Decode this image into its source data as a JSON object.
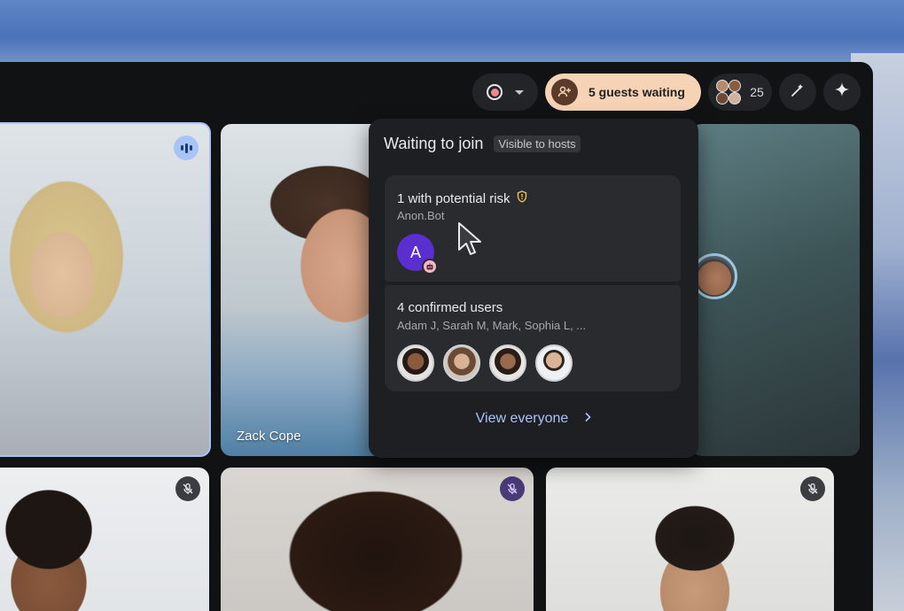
{
  "toolbar": {
    "record_icon": "record-icon",
    "guests_waiting_label": "5 guests waiting",
    "participant_count": "25",
    "colors": {
      "guests_pill_bg": "#f6d3b5",
      "accent": "#a8c4f7"
    }
  },
  "tiles": {
    "zack_name": "Zack Cope"
  },
  "popup": {
    "title": "Waiting to join",
    "visibility_chip": "Visible to hosts",
    "risk_group": {
      "title": "1 with potential risk",
      "names": "Anon.Bot",
      "avatar_initial": "A"
    },
    "confirmed_group": {
      "title": "4 confirmed users",
      "names": "Adam J, Sarah M, Mark, Sophia L, ..."
    },
    "view_everyone_label": "View everyone"
  }
}
